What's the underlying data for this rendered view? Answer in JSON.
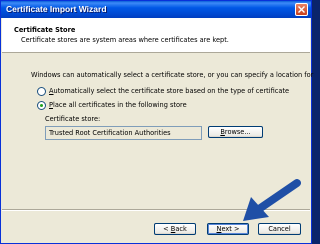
{
  "window": {
    "title": "Certificate Import Wizard"
  },
  "header": {
    "title": "Certificate Store",
    "description": "Certificate stores are system areas where certificates are kept."
  },
  "body": {
    "intro": "Windows can automatically select a certificate store, or you can specify a location for",
    "option_auto": {
      "accel": "A",
      "rest": "utomatically select the certificate store based on the type of certificate",
      "checked": false
    },
    "option_place": {
      "accel": "P",
      "rest": "lace all certificates in the following store",
      "checked": true
    },
    "store_label": "Certificate store:",
    "store_value": "Trusted Root Certification Authorities",
    "browse_accel": "B",
    "browse_rest": "rowse..."
  },
  "footer": {
    "back_prefix": "< ",
    "back_accel": "B",
    "back_rest": "ack",
    "next_accel": "N",
    "next_rest": "ext >",
    "cancel_label": "Cancel"
  },
  "colors": {
    "titlebar": "#0058e6",
    "dialog_bg": "#ece9d8",
    "arrow": "#1f4fa6"
  }
}
